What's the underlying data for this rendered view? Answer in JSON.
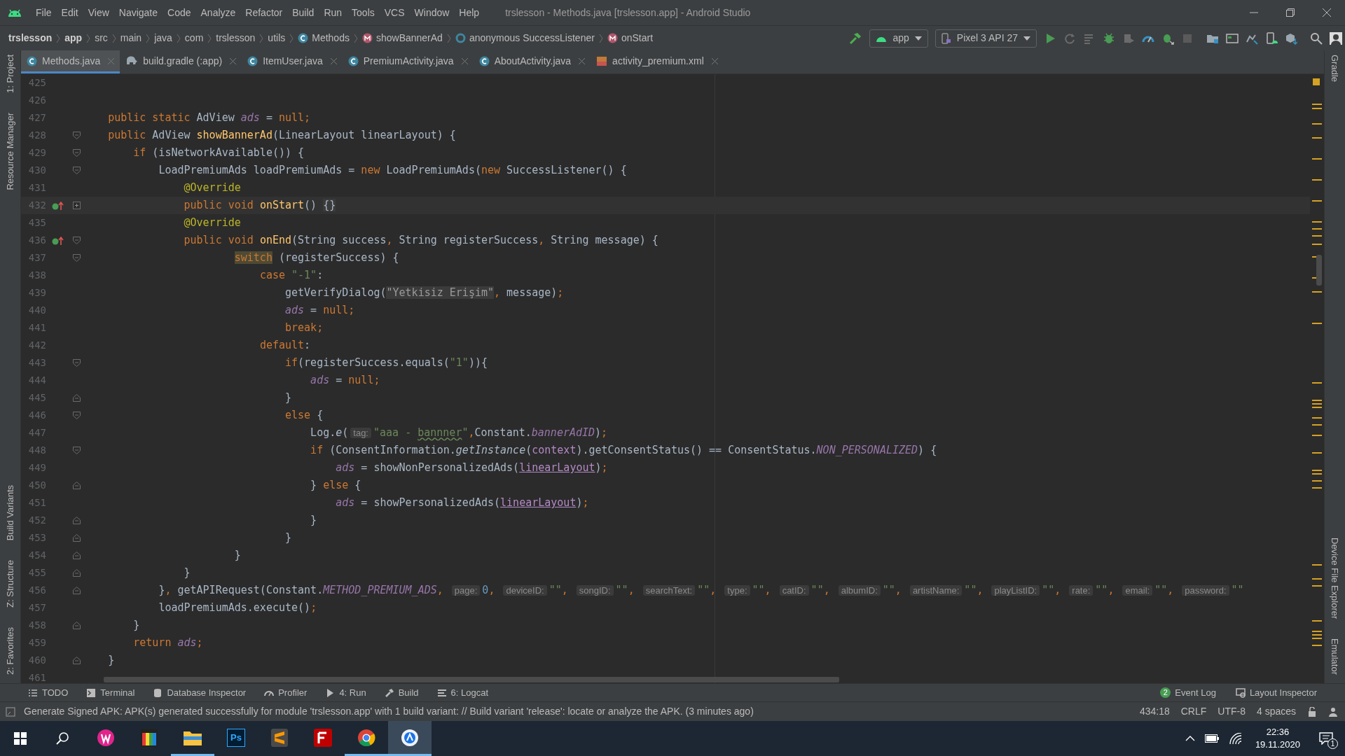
{
  "window": {
    "title": "trslesson - Methods.java [trslesson.app] - Android Studio"
  },
  "menu": [
    "File",
    "Edit",
    "View",
    "Navigate",
    "Code",
    "Analyze",
    "Refactor",
    "Build",
    "Run",
    "Tools",
    "VCS",
    "Window",
    "Help"
  ],
  "breadcrumbs": [
    {
      "label": "trslesson",
      "bold": true
    },
    {
      "label": "app",
      "bold": true
    },
    {
      "label": "src",
      "bold": false
    },
    {
      "label": "main",
      "bold": false
    },
    {
      "label": "java",
      "bold": false
    },
    {
      "label": "com",
      "bold": false
    },
    {
      "label": "trslesson",
      "bold": false
    },
    {
      "label": "utils",
      "bold": false
    },
    {
      "label": "Methods",
      "bold": false,
      "kind": "class"
    },
    {
      "label": "showBannerAd",
      "bold": false,
      "kind": "method"
    },
    {
      "label": "anonymous SuccessListener",
      "bold": false,
      "kind": "anonymous"
    },
    {
      "label": "onStart",
      "bold": false,
      "kind": "method"
    }
  ],
  "toolbar": {
    "run_config": "app",
    "device": "Pixel 3 API 27"
  },
  "tabs": [
    {
      "label": "Methods.java",
      "kind": "class",
      "selected": true
    },
    {
      "label": "build.gradle (:app)",
      "kind": "gradle",
      "selected": false
    },
    {
      "label": "ItemUser.java",
      "kind": "class",
      "selected": false
    },
    {
      "label": "PremiumActivity.java",
      "kind": "class",
      "selected": false
    },
    {
      "label": "AboutActivity.java",
      "kind": "class",
      "selected": false
    },
    {
      "label": "activity_premium.xml",
      "kind": "xml",
      "selected": false
    }
  ],
  "left_tool_strip": {
    "top": [
      "1: Project",
      "Resource Manager"
    ],
    "bottom": [
      "Build Variants",
      "Z: Structure",
      "2: Favorites"
    ]
  },
  "right_tool_strip": {
    "top": [
      "Gradle"
    ],
    "bottom": [
      "Device File Explorer",
      "Emulator"
    ]
  },
  "editor": {
    "lines": [
      {
        "number": "425"
      },
      {
        "number": "426"
      },
      {
        "number": "427",
        "tokens": [
          {
            "kind": "kw",
            "text": "    public static "
          },
          {
            "kind": "plain",
            "text": "AdView "
          },
          {
            "kind": "field",
            "text": "ads"
          },
          {
            "kind": "plain",
            "text": " = "
          },
          {
            "kind": "kw",
            "text": "null;"
          }
        ]
      },
      {
        "number": "428",
        "fold": {
          "kind": "start"
        },
        "tokens": [
          {
            "kind": "kw",
            "text": "    public "
          },
          {
            "kind": "plain",
            "text": "AdView "
          },
          {
            "kind": "decl",
            "text": "showBannerAd"
          },
          {
            "kind": "plain",
            "text": "(LinearLayout linearLayout) {"
          }
        ]
      },
      {
        "number": "429",
        "fold": {
          "kind": "start"
        },
        "tokens": [
          {
            "kind": "kw",
            "text": "        if "
          },
          {
            "kind": "plain",
            "text": "(isNetworkAvailable()) {"
          }
        ]
      },
      {
        "number": "430",
        "fold": {
          "kind": "start"
        },
        "tokens": [
          {
            "kind": "plain",
            "text": "            LoadPremiumAds loadPremiumAds = "
          },
          {
            "kind": "kw",
            "text": "new "
          },
          {
            "kind": "plain",
            "text": "LoadPremiumAds("
          },
          {
            "kind": "kw",
            "text": "new "
          },
          {
            "kind": "plain",
            "text": "SuccessListener() {"
          }
        ]
      },
      {
        "number": "431",
        "tokens": [
          {
            "kind": "ann",
            "text": "                @Override"
          }
        ]
      },
      {
        "number": "432",
        "fold": {
          "kind": "collapsed"
        },
        "marker": {
          "kind": "override"
        },
        "current": true,
        "tokens": [
          {
            "kind": "kw",
            "text": "                public void "
          },
          {
            "kind": "decl",
            "text": "onStart"
          },
          {
            "kind": "plain",
            "text": "() "
          },
          {
            "kind": "brace",
            "text": "{}"
          }
        ]
      },
      {
        "number": "435",
        "tokens": [
          {
            "kind": "ann",
            "text": "                @Override"
          }
        ]
      },
      {
        "number": "436",
        "fold": {
          "kind": "start"
        },
        "marker": {
          "kind": "override"
        },
        "tokens": [
          {
            "kind": "kw",
            "text": "                public void "
          },
          {
            "kind": "decl",
            "text": "onEnd"
          },
          {
            "kind": "plain",
            "text": "(String success"
          },
          {
            "kind": "kw",
            "text": ", "
          },
          {
            "kind": "plain",
            "text": "String registerSuccess"
          },
          {
            "kind": "kw",
            "text": ", "
          },
          {
            "kind": "plain",
            "text": "String message) {"
          }
        ]
      },
      {
        "number": "437",
        "fold": {
          "kind": "start"
        },
        "tokens": [
          {
            "kind": "match",
            "text": "                        switch"
          },
          {
            "kind": "plain",
            "text": " (registerSuccess) {"
          }
        ]
      },
      {
        "number": "438",
        "tokens": [
          {
            "kind": "kw",
            "text": "                            case "
          },
          {
            "kind": "str",
            "text": "\"-1\""
          },
          {
            "kind": "plain",
            "text": ":"
          }
        ]
      },
      {
        "number": "439",
        "tokens": [
          {
            "kind": "plain",
            "text": "                                getVerifyDialog("
          },
          {
            "kind": "strbg",
            "text": "\"Yetkisiz Erişim\""
          },
          {
            "kind": "kw",
            "text": ", "
          },
          {
            "kind": "plain",
            "text": "message)"
          },
          {
            "kind": "kw",
            "text": ";"
          }
        ]
      },
      {
        "number": "440",
        "tokens": [
          {
            "kind": "field",
            "text": "                                ads"
          },
          {
            "kind": "plain",
            "text": " = "
          },
          {
            "kind": "kw",
            "text": "null;"
          }
        ]
      },
      {
        "number": "441",
        "tokens": [
          {
            "kind": "kw",
            "text": "                                break;"
          }
        ]
      },
      {
        "number": "442",
        "tokens": [
          {
            "kind": "kw",
            "text": "                            default"
          },
          {
            "kind": "plain",
            "text": ":"
          }
        ]
      },
      {
        "number": "443",
        "fold": {
          "kind": "start"
        },
        "tokens": [
          {
            "kind": "kw",
            "text": "                                if"
          },
          {
            "kind": "plain",
            "text": "(registerSuccess.equals("
          },
          {
            "kind": "str",
            "text": "\"1\""
          },
          {
            "kind": "plain",
            "text": ")){"
          }
        ]
      },
      {
        "number": "444",
        "tokens": [
          {
            "kind": "field",
            "text": "                                    ads"
          },
          {
            "kind": "plain",
            "text": " = "
          },
          {
            "kind": "kw",
            "text": "null;"
          }
        ]
      },
      {
        "number": "445",
        "fold": {
          "kind": "end"
        },
        "tokens": [
          {
            "kind": "plain",
            "text": "                                }"
          }
        ]
      },
      {
        "number": "446",
        "fold": {
          "kind": "start"
        },
        "tokens": [
          {
            "kind": "kw",
            "text": "                                else "
          },
          {
            "kind": "plain",
            "text": "{"
          }
        ]
      },
      {
        "number": "447",
        "tokens": [
          {
            "kind": "plain",
            "text": "                                    Log."
          },
          {
            "kind": "italic",
            "text": "e"
          },
          {
            "kind": "plain",
            "text": "("
          },
          {
            "kind": "hint",
            "text": "tag:"
          },
          {
            "kind": "str",
            "text": "\"aaa - "
          },
          {
            "kind": "typo",
            "text": "bannner"
          },
          {
            "kind": "str",
            "text": "\""
          },
          {
            "kind": "kw",
            "text": ","
          },
          {
            "kind": "plain",
            "text": "Constant."
          },
          {
            "kind": "field",
            "text": "bannerAdID"
          },
          {
            "kind": "plain",
            "text": ")"
          },
          {
            "kind": "kw",
            "text": ";"
          }
        ]
      },
      {
        "number": "448",
        "fold": {
          "kind": "start"
        },
        "tokens": [
          {
            "kind": "kw",
            "text": "                                    if "
          },
          {
            "kind": "plain",
            "text": "(ConsentInformation."
          },
          {
            "kind": "italic",
            "text": "getInstance"
          },
          {
            "kind": "plain",
            "text": "("
          },
          {
            "kind": "param",
            "text": "context"
          },
          {
            "kind": "plain",
            "text": ").getConsentStatus() == ConsentStatus."
          },
          {
            "kind": "field",
            "text": "NON_PERSONALIZED"
          },
          {
            "kind": "plain",
            "text": ") {"
          }
        ]
      },
      {
        "number": "449",
        "tokens": [
          {
            "kind": "field",
            "text": "                                        ads"
          },
          {
            "kind": "plain",
            "text": " = showNonPersonalizedAds("
          },
          {
            "kind": "link",
            "text": "linearLayout"
          },
          {
            "kind": "plain",
            "text": ")"
          },
          {
            "kind": "kw",
            "text": ";"
          }
        ]
      },
      {
        "number": "450",
        "fold": {
          "kind": "end"
        },
        "tokens": [
          {
            "kind": "plain",
            "text": "                                    } "
          },
          {
            "kind": "kw",
            "text": "else "
          },
          {
            "kind": "plain",
            "text": "{"
          }
        ]
      },
      {
        "number": "451",
        "tokens": [
          {
            "kind": "field",
            "text": "                                        ads"
          },
          {
            "kind": "plain",
            "text": " = showPersonalizedAds("
          },
          {
            "kind": "link",
            "text": "linearLayout"
          },
          {
            "kind": "plain",
            "text": ")"
          },
          {
            "kind": "kw",
            "text": ";"
          }
        ]
      },
      {
        "number": "452",
        "fold": {
          "kind": "end"
        },
        "tokens": [
          {
            "kind": "plain",
            "text": "                                    }"
          }
        ]
      },
      {
        "number": "453",
        "fold": {
          "kind": "end"
        },
        "tokens": [
          {
            "kind": "plain",
            "text": "                                }"
          }
        ]
      },
      {
        "number": "454",
        "fold": {
          "kind": "end"
        },
        "tokens": [
          {
            "kind": "plain",
            "text": "                        }"
          }
        ]
      },
      {
        "number": "455",
        "fold": {
          "kind": "end"
        },
        "tokens": [
          {
            "kind": "plain",
            "text": "                }"
          }
        ]
      },
      {
        "number": "456",
        "fold": {
          "kind": "end"
        },
        "tokens": [
          {
            "kind": "plain",
            "text": "            }"
          },
          {
            "kind": "kw",
            "text": ", "
          },
          {
            "kind": "plain",
            "text": "getAPIRequest(Constant."
          },
          {
            "kind": "field",
            "text": "METHOD_PREMIUM_ADS"
          },
          {
            "kind": "kw",
            "text": ", "
          },
          {
            "kind": "hint",
            "text": "page:"
          },
          {
            "kind": "num",
            "text": "0"
          },
          {
            "kind": "kw",
            "text": ", "
          },
          {
            "kind": "hint",
            "text": "deviceID:"
          },
          {
            "kind": "str",
            "text": "\"\""
          },
          {
            "kind": "kw",
            "text": ", "
          },
          {
            "kind": "hint",
            "text": "songID:"
          },
          {
            "kind": "str",
            "text": "\"\""
          },
          {
            "kind": "kw",
            "text": ", "
          },
          {
            "kind": "hint",
            "text": "searchText:"
          },
          {
            "kind": "str",
            "text": "\"\""
          },
          {
            "kind": "kw",
            "text": ", "
          },
          {
            "kind": "hint",
            "text": "type:"
          },
          {
            "kind": "str",
            "text": "\"\""
          },
          {
            "kind": "kw",
            "text": ", "
          },
          {
            "kind": "hint",
            "text": "catID:"
          },
          {
            "kind": "str",
            "text": "\"\""
          },
          {
            "kind": "kw",
            "text": ", "
          },
          {
            "kind": "hint",
            "text": "albumID:"
          },
          {
            "kind": "str",
            "text": "\"\""
          },
          {
            "kind": "kw",
            "text": ", "
          },
          {
            "kind": "hint",
            "text": "artistName:"
          },
          {
            "kind": "str",
            "text": "\"\""
          },
          {
            "kind": "kw",
            "text": ", "
          },
          {
            "kind": "hint",
            "text": "playListID:"
          },
          {
            "kind": "str",
            "text": "\"\""
          },
          {
            "kind": "kw",
            "text": ", "
          },
          {
            "kind": "hint",
            "text": "rate:"
          },
          {
            "kind": "str",
            "text": "\"\""
          },
          {
            "kind": "kw",
            "text": ", "
          },
          {
            "kind": "hint",
            "text": "email:"
          },
          {
            "kind": "str",
            "text": "\"\""
          },
          {
            "kind": "kw",
            "text": ", "
          },
          {
            "kind": "hint",
            "text": "password:"
          },
          {
            "kind": "str",
            "text": "\"\""
          }
        ]
      },
      {
        "number": "457",
        "tokens": [
          {
            "kind": "plain",
            "text": "            loadPremiumAds.execute()"
          },
          {
            "kind": "kw",
            "text": ";"
          }
        ]
      },
      {
        "number": "458",
        "fold": {
          "kind": "end"
        },
        "tokens": [
          {
            "kind": "plain",
            "text": "        }"
          }
        ]
      },
      {
        "number": "459",
        "tokens": [
          {
            "kind": "kw",
            "text": "        return "
          },
          {
            "kind": "field",
            "text": "ads"
          },
          {
            "kind": "kw",
            "text": ";"
          }
        ]
      },
      {
        "number": "460",
        "fold": {
          "kind": "end"
        },
        "tokens": [
          {
            "kind": "plain",
            "text": "    }"
          }
        ]
      },
      {
        "number": "461"
      }
    ]
  },
  "tool_windows": [
    {
      "label": "TODO",
      "kind": "todo"
    },
    {
      "label": "Terminal",
      "kind": "terminal"
    },
    {
      "label": "Database Inspector",
      "kind": "database"
    },
    {
      "label": "Profiler",
      "kind": "profiler"
    },
    {
      "label": "4: Run",
      "kind": "run"
    },
    {
      "label": "Build",
      "kind": "build"
    },
    {
      "label": "6: Logcat",
      "kind": "logcat"
    }
  ],
  "tool_windows_right": [
    {
      "label": "Event Log",
      "badge": "2"
    },
    {
      "label": "Layout Inspector",
      "kind": "layout"
    }
  ],
  "status_bar": {
    "message": "Generate Signed APK: APK(s) generated successfully for module 'trslesson.app' with 1 build variant: // Build variant 'release': locate or analyze the APK. (3 minutes ago)",
    "items": [
      "434:18",
      "CRLF",
      "UTF-8",
      "4 spaces"
    ]
  },
  "taskbar": {
    "apps": [
      {
        "kind": "wamp",
        "running": false,
        "selected": false
      },
      {
        "kind": "colors",
        "running": false,
        "selected": false
      },
      {
        "kind": "explorer",
        "running": true,
        "selected": false
      },
      {
        "kind": "photoshop",
        "label": "Ps",
        "running": false,
        "selected": false
      },
      {
        "kind": "sublime",
        "running": false,
        "selected": false
      },
      {
        "kind": "filezilla",
        "running": false,
        "selected": false
      },
      {
        "kind": "chrome",
        "running": true,
        "selected": false
      },
      {
        "kind": "studio",
        "running": true,
        "selected": true
      }
    ],
    "time": "22:36",
    "date": "19.11.2020",
    "notifications": "1"
  }
}
